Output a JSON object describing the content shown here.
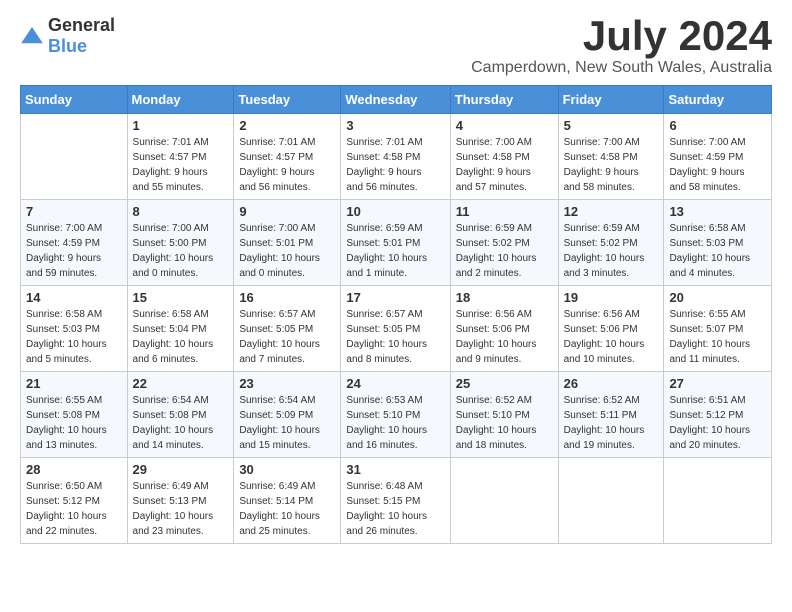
{
  "header": {
    "logo": {
      "general": "General",
      "blue": "Blue"
    },
    "title": "July 2024",
    "location": "Camperdown, New South Wales, Australia"
  },
  "calendar": {
    "days_of_week": [
      "Sunday",
      "Monday",
      "Tuesday",
      "Wednesday",
      "Thursday",
      "Friday",
      "Saturday"
    ],
    "weeks": [
      [
        {
          "day": "",
          "content": ""
        },
        {
          "day": "1",
          "content": "Sunrise: 7:01 AM\nSunset: 4:57 PM\nDaylight: 9 hours\nand 55 minutes."
        },
        {
          "day": "2",
          "content": "Sunrise: 7:01 AM\nSunset: 4:57 PM\nDaylight: 9 hours\nand 56 minutes."
        },
        {
          "day": "3",
          "content": "Sunrise: 7:01 AM\nSunset: 4:58 PM\nDaylight: 9 hours\nand 56 minutes."
        },
        {
          "day": "4",
          "content": "Sunrise: 7:00 AM\nSunset: 4:58 PM\nDaylight: 9 hours\nand 57 minutes."
        },
        {
          "day": "5",
          "content": "Sunrise: 7:00 AM\nSunset: 4:58 PM\nDaylight: 9 hours\nand 58 minutes."
        },
        {
          "day": "6",
          "content": "Sunrise: 7:00 AM\nSunset: 4:59 PM\nDaylight: 9 hours\nand 58 minutes."
        }
      ],
      [
        {
          "day": "7",
          "content": "Sunrise: 7:00 AM\nSunset: 4:59 PM\nDaylight: 9 hours\nand 59 minutes."
        },
        {
          "day": "8",
          "content": "Sunrise: 7:00 AM\nSunset: 5:00 PM\nDaylight: 10 hours\nand 0 minutes."
        },
        {
          "day": "9",
          "content": "Sunrise: 7:00 AM\nSunset: 5:01 PM\nDaylight: 10 hours\nand 0 minutes."
        },
        {
          "day": "10",
          "content": "Sunrise: 6:59 AM\nSunset: 5:01 PM\nDaylight: 10 hours\nand 1 minute."
        },
        {
          "day": "11",
          "content": "Sunrise: 6:59 AM\nSunset: 5:02 PM\nDaylight: 10 hours\nand 2 minutes."
        },
        {
          "day": "12",
          "content": "Sunrise: 6:59 AM\nSunset: 5:02 PM\nDaylight: 10 hours\nand 3 minutes."
        },
        {
          "day": "13",
          "content": "Sunrise: 6:58 AM\nSunset: 5:03 PM\nDaylight: 10 hours\nand 4 minutes."
        }
      ],
      [
        {
          "day": "14",
          "content": "Sunrise: 6:58 AM\nSunset: 5:03 PM\nDaylight: 10 hours\nand 5 minutes."
        },
        {
          "day": "15",
          "content": "Sunrise: 6:58 AM\nSunset: 5:04 PM\nDaylight: 10 hours\nand 6 minutes."
        },
        {
          "day": "16",
          "content": "Sunrise: 6:57 AM\nSunset: 5:05 PM\nDaylight: 10 hours\nand 7 minutes."
        },
        {
          "day": "17",
          "content": "Sunrise: 6:57 AM\nSunset: 5:05 PM\nDaylight: 10 hours\nand 8 minutes."
        },
        {
          "day": "18",
          "content": "Sunrise: 6:56 AM\nSunset: 5:06 PM\nDaylight: 10 hours\nand 9 minutes."
        },
        {
          "day": "19",
          "content": "Sunrise: 6:56 AM\nSunset: 5:06 PM\nDaylight: 10 hours\nand 10 minutes."
        },
        {
          "day": "20",
          "content": "Sunrise: 6:55 AM\nSunset: 5:07 PM\nDaylight: 10 hours\nand 11 minutes."
        }
      ],
      [
        {
          "day": "21",
          "content": "Sunrise: 6:55 AM\nSunset: 5:08 PM\nDaylight: 10 hours\nand 13 minutes."
        },
        {
          "day": "22",
          "content": "Sunrise: 6:54 AM\nSunset: 5:08 PM\nDaylight: 10 hours\nand 14 minutes."
        },
        {
          "day": "23",
          "content": "Sunrise: 6:54 AM\nSunset: 5:09 PM\nDaylight: 10 hours\nand 15 minutes."
        },
        {
          "day": "24",
          "content": "Sunrise: 6:53 AM\nSunset: 5:10 PM\nDaylight: 10 hours\nand 16 minutes."
        },
        {
          "day": "25",
          "content": "Sunrise: 6:52 AM\nSunset: 5:10 PM\nDaylight: 10 hours\nand 18 minutes."
        },
        {
          "day": "26",
          "content": "Sunrise: 6:52 AM\nSunset: 5:11 PM\nDaylight: 10 hours\nand 19 minutes."
        },
        {
          "day": "27",
          "content": "Sunrise: 6:51 AM\nSunset: 5:12 PM\nDaylight: 10 hours\nand 20 minutes."
        }
      ],
      [
        {
          "day": "28",
          "content": "Sunrise: 6:50 AM\nSunset: 5:12 PM\nDaylight: 10 hours\nand 22 minutes."
        },
        {
          "day": "29",
          "content": "Sunrise: 6:49 AM\nSunset: 5:13 PM\nDaylight: 10 hours\nand 23 minutes."
        },
        {
          "day": "30",
          "content": "Sunrise: 6:49 AM\nSunset: 5:14 PM\nDaylight: 10 hours\nand 25 minutes."
        },
        {
          "day": "31",
          "content": "Sunrise: 6:48 AM\nSunset: 5:15 PM\nDaylight: 10 hours\nand 26 minutes."
        },
        {
          "day": "",
          "content": ""
        },
        {
          "day": "",
          "content": ""
        },
        {
          "day": "",
          "content": ""
        }
      ]
    ]
  }
}
